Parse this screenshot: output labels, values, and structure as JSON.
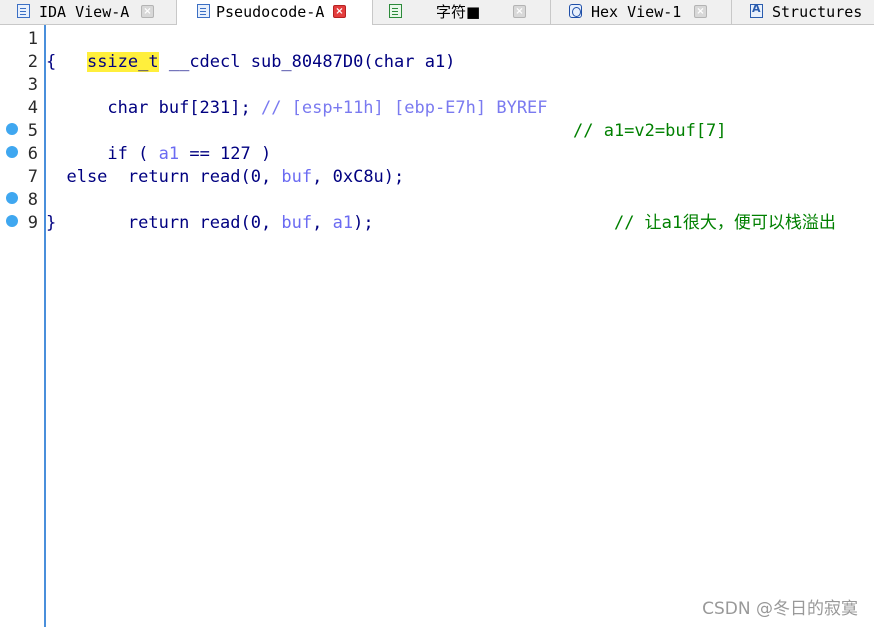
{
  "tabs": [
    {
      "label": "IDA View-A",
      "icon": "ida-view-icon",
      "active": false
    },
    {
      "label": "Pseudocode-A",
      "icon": "pseudocode-icon",
      "active": true
    },
    {
      "label": "字符■",
      "icon": "strings-icon",
      "active": false
    },
    {
      "label": "Hex View-1",
      "icon": "hex-view-icon",
      "active": false
    },
    {
      "label": "Structures",
      "icon": "structures-icon",
      "active": false
    }
  ],
  "close_glyph": "×",
  "code": {
    "line_numbers": [
      "1",
      "2",
      "3",
      "4",
      "5",
      "6",
      "7",
      "8",
      "9"
    ],
    "l1": {
      "type": "ssize_t",
      "rest": " __cdecl sub_80487D0(char a1)"
    },
    "l2": "{",
    "l3": {
      "code": "  char buf[231]; ",
      "comment": "// [esp+11h] [ebp-E7h] BYREF"
    },
    "l4": "",
    "l5": {
      "a": "  if ( ",
      "var": "a1",
      "b": " == 127 )",
      "comment": "// a1=v2=buf[7]"
    },
    "l6": {
      "a": "    return read(0, ",
      "var": "buf",
      "b": ", 0xC8u);"
    },
    "l7": "  else",
    "l8": {
      "a": "    return read(0, ",
      "var1": "buf",
      "mid": ", ",
      "var2": "a1",
      "b": ");",
      "comment_prefix": "// ",
      "comment_text": "让a1很大，便可以栈溢出"
    },
    "l9": "}"
  },
  "watermark": "CSDN @冬日的寂寞",
  "colors": {
    "keyword": "#000080",
    "variable": "#6b6bf2",
    "comment_blue": "#7a7af0",
    "comment_green": "#008000",
    "highlight": "#ffef3c",
    "breakpoint": "#3fa7f0",
    "gutter_border": "#4a8fdb"
  }
}
